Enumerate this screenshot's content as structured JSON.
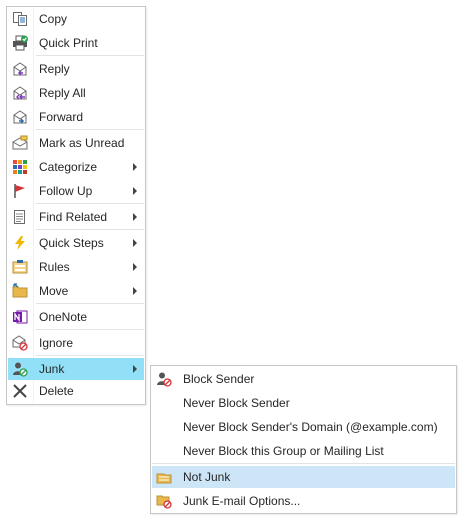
{
  "context_menu": {
    "items": [
      {
        "id": "copy",
        "label": "Copy",
        "icon": "copy-icon"
      },
      {
        "id": "quick-print",
        "label": "Quick Print",
        "icon": "quick-print-icon"
      },
      {
        "id": "reply",
        "label": "Reply",
        "icon": "reply-icon"
      },
      {
        "id": "reply-all",
        "label": "Reply All",
        "icon": "reply-all-icon"
      },
      {
        "id": "forward",
        "label": "Forward",
        "icon": "forward-icon"
      },
      {
        "id": "mark-unread",
        "label": "Mark as Unread",
        "icon": "mark-unread-icon"
      },
      {
        "id": "categorize",
        "label": "Categorize",
        "icon": "categorize-icon",
        "submenu": true
      },
      {
        "id": "follow-up",
        "label": "Follow Up",
        "icon": "flag-icon",
        "submenu": true
      },
      {
        "id": "find-related",
        "label": "Find Related",
        "icon": "find-related-icon",
        "submenu": true
      },
      {
        "id": "quick-steps",
        "label": "Quick Steps",
        "icon": "lightning-icon",
        "submenu": true
      },
      {
        "id": "rules",
        "label": "Rules",
        "icon": "rules-icon",
        "submenu": true
      },
      {
        "id": "move",
        "label": "Move",
        "icon": "folder-move-icon",
        "submenu": true
      },
      {
        "id": "onenote",
        "label": "OneNote",
        "icon": "onenote-icon"
      },
      {
        "id": "ignore",
        "label": "Ignore",
        "icon": "ignore-icon"
      },
      {
        "id": "junk",
        "label": "Junk",
        "icon": "junk-icon",
        "submenu": true,
        "highlighted": true
      },
      {
        "id": "delete",
        "label": "Delete",
        "icon": "delete-icon"
      }
    ]
  },
  "junk_submenu": {
    "items": [
      {
        "id": "block-sender",
        "label": "Block Sender",
        "icon": "block-sender-icon"
      },
      {
        "id": "never-block-sender",
        "label": "Never Block Sender"
      },
      {
        "id": "never-block-domain",
        "label": "Never Block Sender's Domain (@example.com)"
      },
      {
        "id": "never-block-group",
        "label": "Never Block this Group or Mailing List"
      },
      {
        "id": "not-junk",
        "label": "Not Junk",
        "icon": "not-junk-icon",
        "highlighted": true
      },
      {
        "id": "junk-options",
        "label": "Junk E-mail Options...",
        "icon": "junk-options-icon"
      }
    ]
  },
  "colors": {
    "highlight_main": "#91e0f7",
    "highlight_sub": "#cde6f7",
    "accent_blue": "#2b6cb0",
    "flag_red": "#d13438",
    "onenote_purple": "#7719aa"
  }
}
